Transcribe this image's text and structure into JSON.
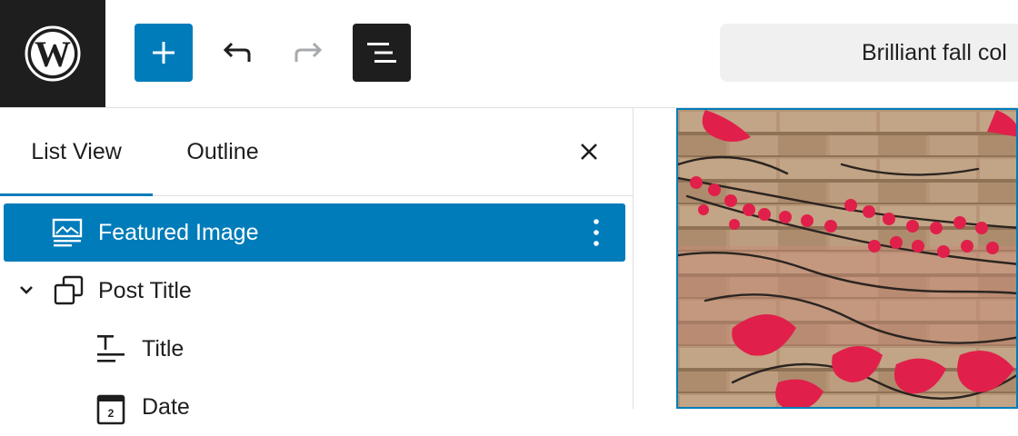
{
  "header": {
    "logo_icon": "wordpress-logo-icon",
    "add_icon": "plus-icon",
    "undo_icon": "undo-icon",
    "redo_icon": "redo-icon",
    "document_overview_icon": "list-view-icon",
    "document_title": "Brilliant fall col"
  },
  "sidebar": {
    "tabs": [
      {
        "label": "List View",
        "active": true
      },
      {
        "label": "Outline",
        "active": false
      }
    ],
    "close_icon": "close-icon",
    "items": [
      {
        "label": "Featured Image",
        "icon": "image-icon",
        "selected": true,
        "options_icon": "more-vertical-icon"
      },
      {
        "label": "Post Title",
        "icon": "group-icon",
        "expanded": true,
        "toggle_icon": "chevron-down-icon"
      },
      {
        "label": "Title",
        "icon": "title-icon"
      },
      {
        "label": "Date",
        "icon": "calendar-icon"
      }
    ]
  },
  "colors": {
    "accent": "#007cba",
    "dark": "#1e1e1e",
    "doc_bar_bg": "#f0f0f0",
    "vine_red": "#e0204a"
  }
}
